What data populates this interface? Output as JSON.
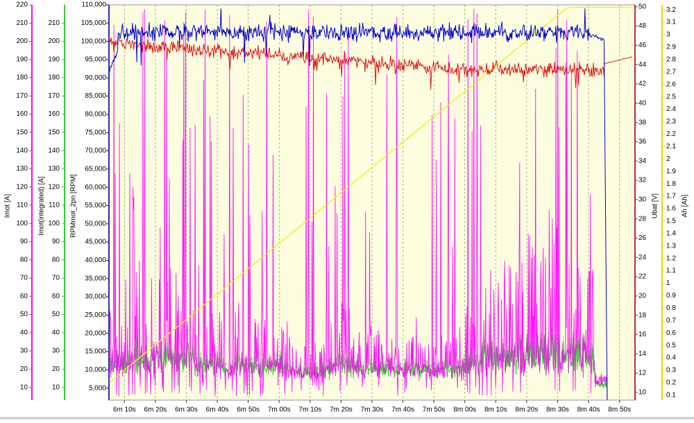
{
  "colors": {
    "plot_bg": "#fdfde0",
    "grid": "#8a8a70",
    "imot": "#ff00ff",
    "imot_integrated": "#33dd33",
    "rpm": "#0000cc",
    "ubat": "#dd0000",
    "ah": "#eeee22",
    "mix_overlap": "#8a7a8a"
  },
  "chart_data": {
    "type": "line",
    "x": {
      "ticks": [
        "6m 10s",
        "6m 20s",
        "6m 30s",
        "6m 40s",
        "6m 50s",
        "7m 00s",
        "7m 10s",
        "7m 20s",
        "7m 30s",
        "7m 40s",
        "7m 50s",
        "8m 00s",
        "8m 10s",
        "8m 20s",
        "8m 30s",
        "8m 40s",
        "8m 50s"
      ],
      "range_s": [
        365,
        535
      ],
      "tick_start_s": 370,
      "tick_step_s": 10
    },
    "axes": [
      {
        "id": "imot",
        "label": "Imot [A]",
        "side": "left",
        "range": [
          3,
          220
        ],
        "ticks": [
          220,
          210,
          200,
          190,
          180,
          170,
          160,
          150,
          140,
          130,
          120,
          110,
          100,
          90,
          80,
          70,
          60,
          50,
          40,
          30,
          20,
          10
        ]
      },
      {
        "id": "imot_integrated",
        "label": "Imot(integrated) [A]",
        "side": "left",
        "range": [
          3,
          220
        ],
        "ticks": [
          210,
          200,
          190,
          180,
          170,
          160,
          150,
          140,
          130,
          120,
          110,
          100,
          90,
          80,
          70,
          60,
          50,
          40,
          30,
          20,
          10
        ]
      },
      {
        "id": "rpm",
        "label": "RPMmot_2pn [RPM]",
        "side": "left",
        "range": [
          1700,
          110000
        ],
        "ticks": [
          "110,000",
          "105,000",
          "100,000",
          "95,000",
          "90,000",
          "85,000",
          "80,000",
          "75,000",
          "70,000",
          "65,000",
          "60,000",
          "55,000",
          "50,000",
          "45,000",
          "40,000",
          "35,000",
          "30,000",
          "25,000",
          "20,000",
          "15,000",
          "10,000",
          "5,000"
        ]
      },
      {
        "id": "ubat",
        "label": "Ubat [V]",
        "side": "right",
        "range": [
          9.2,
          50.2
        ],
        "ticks": [
          50,
          48,
          46,
          44,
          42,
          40,
          38,
          36,
          34,
          32,
          30,
          28,
          26,
          24,
          22,
          20,
          18,
          16,
          14,
          12,
          10
        ]
      },
      {
        "id": "ah",
        "label": "Ah [Ah]",
        "side": "right",
        "range": [
          0.06,
          3.24
        ],
        "ticks": [
          3.2,
          3.1,
          3,
          2.9,
          2.8,
          2.7,
          2.6,
          2.5,
          2.4,
          2.3,
          2.2,
          2.1,
          2,
          1.9,
          1.8,
          1.7,
          1.6,
          1.5,
          1.4,
          1.3,
          1.2,
          1.1,
          1,
          0.9,
          0.8,
          0.7,
          0.6,
          0.5,
          0.4,
          0.3,
          0.2,
          0.1
        ]
      }
    ],
    "series": [
      {
        "axis": "rpm",
        "t_range_s": [
          365,
          525
        ],
        "baseline": 102500,
        "noise": 3500,
        "start_value": 92000
      },
      {
        "axis": "ubat",
        "t_range_s": [
          365,
          534
        ],
        "start_value": 46.3,
        "end_mid": 43.5,
        "final": 44.8,
        "noise": 1.1
      },
      {
        "axis": "ah",
        "t_range_s": [
          365,
          534
        ],
        "start_value": 0.2,
        "end_value": 3.22
      },
      {
        "axis": "imot_integrated",
        "t_range_s": [
          365,
          525
        ],
        "min": 10,
        "typical": 18,
        "peak": 160
      },
      {
        "axis": "imot",
        "t_range_s": [
          365,
          526
        ],
        "min": 5,
        "typical": 25,
        "peak": 218
      }
    ]
  }
}
